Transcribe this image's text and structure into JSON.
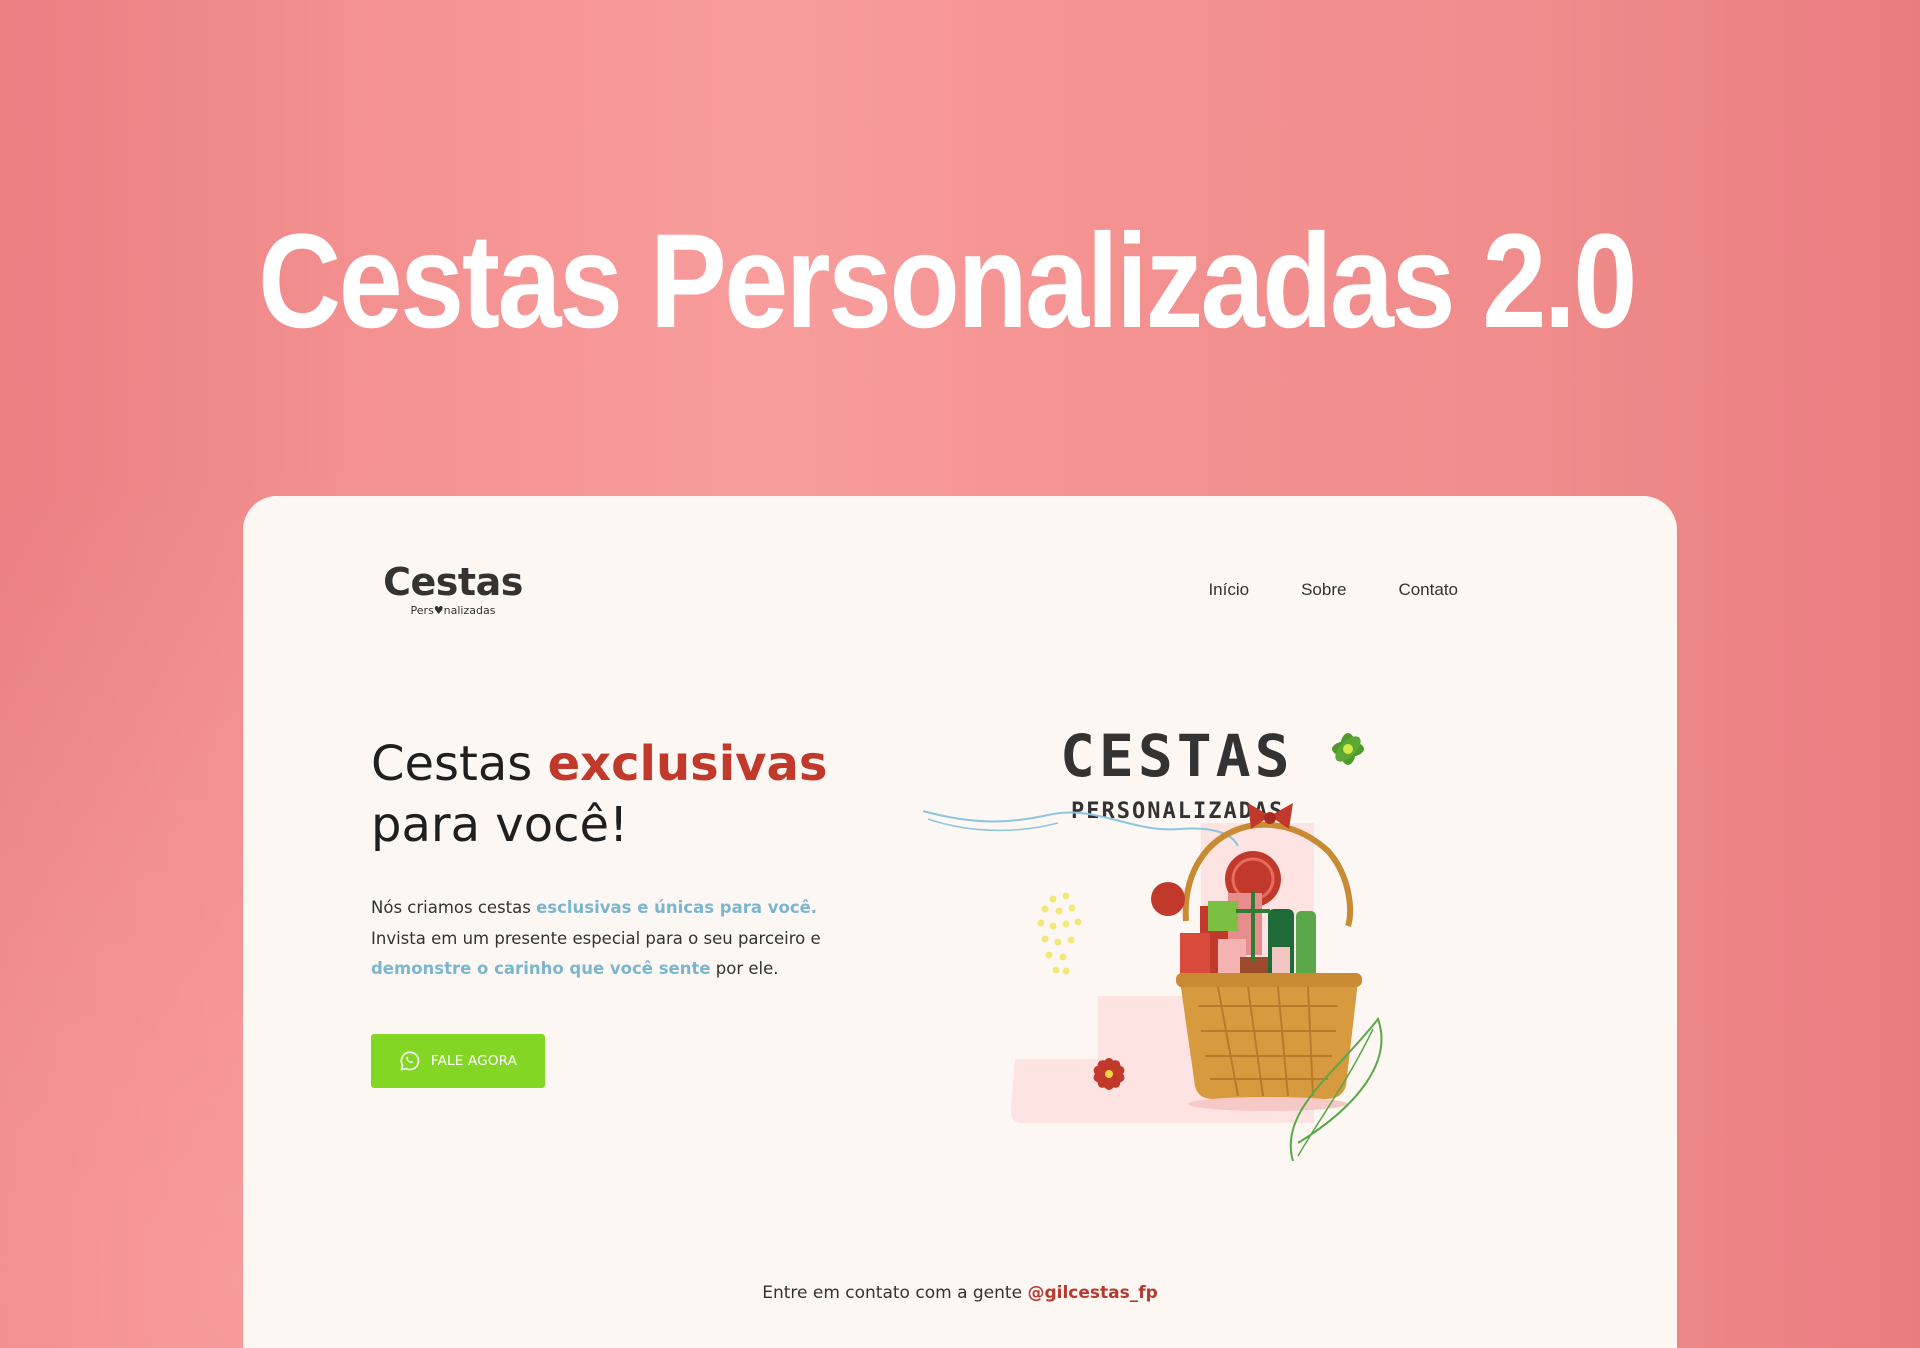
{
  "hero": {
    "title": "Cestas Personalizadas 2.0"
  },
  "logo": {
    "main": "Cestas",
    "sub": "Pers♥nalizadas"
  },
  "nav": {
    "items": [
      "Início",
      "Sobre",
      "Contato"
    ]
  },
  "headline": {
    "part1": "Cestas ",
    "highlight": "exclusivas",
    "part2": "para você!"
  },
  "description": {
    "t1": "Nós criamos cestas ",
    "h1": "esclusivas e únicas para você.",
    "t2": "Invista em um presente especial para o seu parceiro e ",
    "h2": "demonstre o carinho que você sente",
    "t3": " por ele."
  },
  "cta": {
    "label": "FALE AGORA",
    "icon": "whatsapp-icon"
  },
  "illustration": {
    "title": "CESTAS",
    "subtitle": "PERSONALIZADAS"
  },
  "footer": {
    "text": "Entre em contato com a gente ",
    "handle": "@gilcestas_fp"
  },
  "colors": {
    "background": "#f49191",
    "card": "#fdf7f4",
    "accent_red": "#c0392b",
    "accent_blue": "#7ab6d0",
    "cta_green": "#84d624"
  }
}
